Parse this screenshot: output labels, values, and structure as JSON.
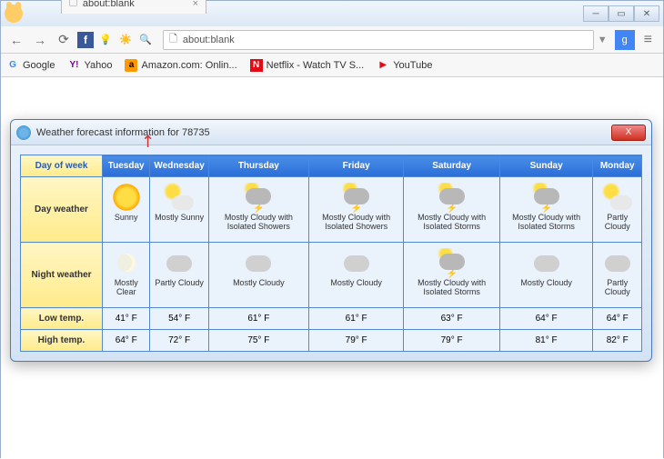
{
  "browser": {
    "tab_title": "about:blank",
    "omnibox_value": "about:blank",
    "back": "←",
    "forward": "→",
    "reload": "⟳",
    "menu": "≡",
    "search": "g",
    "dropdown": "▼"
  },
  "bookmarks": [
    {
      "label": "Google",
      "icon": "G"
    },
    {
      "label": "Yahoo",
      "icon": "Y!"
    },
    {
      "label": "Amazon.com: Onlin...",
      "icon": "a"
    },
    {
      "label": "Netflix - Watch TV S...",
      "icon": "N"
    },
    {
      "label": "YouTube",
      "icon": "▶"
    }
  ],
  "dialog": {
    "title": "Weather forecast information for 78735",
    "close": "X",
    "corner": "Day of week",
    "days": [
      "Tuesday",
      "Wednesday",
      "Thursday",
      "Friday",
      "Saturday",
      "Sunday",
      "Monday"
    ],
    "row_headers": {
      "day": "Day weather",
      "night": "Night weather",
      "low": "Low temp.",
      "high": "High temp."
    },
    "day_weather": [
      {
        "label": "Sunny",
        "icon": "sun"
      },
      {
        "label": "Mostly Sunny",
        "icon": "partly"
      },
      {
        "label": "Mostly Cloudy with Isolated Showers",
        "icon": "storm"
      },
      {
        "label": "Mostly Cloudy with Isolated Showers",
        "icon": "storm"
      },
      {
        "label": "Mostly Cloudy with Isolated Storms",
        "icon": "storm"
      },
      {
        "label": "Mostly Cloudy with Isolated Storms",
        "icon": "storm"
      },
      {
        "label": "Partly Cloudy",
        "icon": "partly"
      }
    ],
    "night_weather": [
      {
        "label": "Mostly Clear",
        "icon": "night-clear"
      },
      {
        "label": "Partly Cloudy",
        "icon": "cloudy"
      },
      {
        "label": "Mostly Cloudy",
        "icon": "cloudy"
      },
      {
        "label": "Mostly Cloudy",
        "icon": "cloudy"
      },
      {
        "label": "Mostly Cloudy with Isolated Storms",
        "icon": "storm"
      },
      {
        "label": "Mostly Cloudy",
        "icon": "cloudy"
      },
      {
        "label": "Partly Cloudy",
        "icon": "cloudy"
      }
    ],
    "low_temp": [
      "41° F",
      "54° F",
      "61° F",
      "61° F",
      "63° F",
      "64° F",
      "64° F"
    ],
    "high_temp": [
      "64° F",
      "72° F",
      "75° F",
      "79° F",
      "79° F",
      "81° F",
      "82° F"
    ]
  }
}
